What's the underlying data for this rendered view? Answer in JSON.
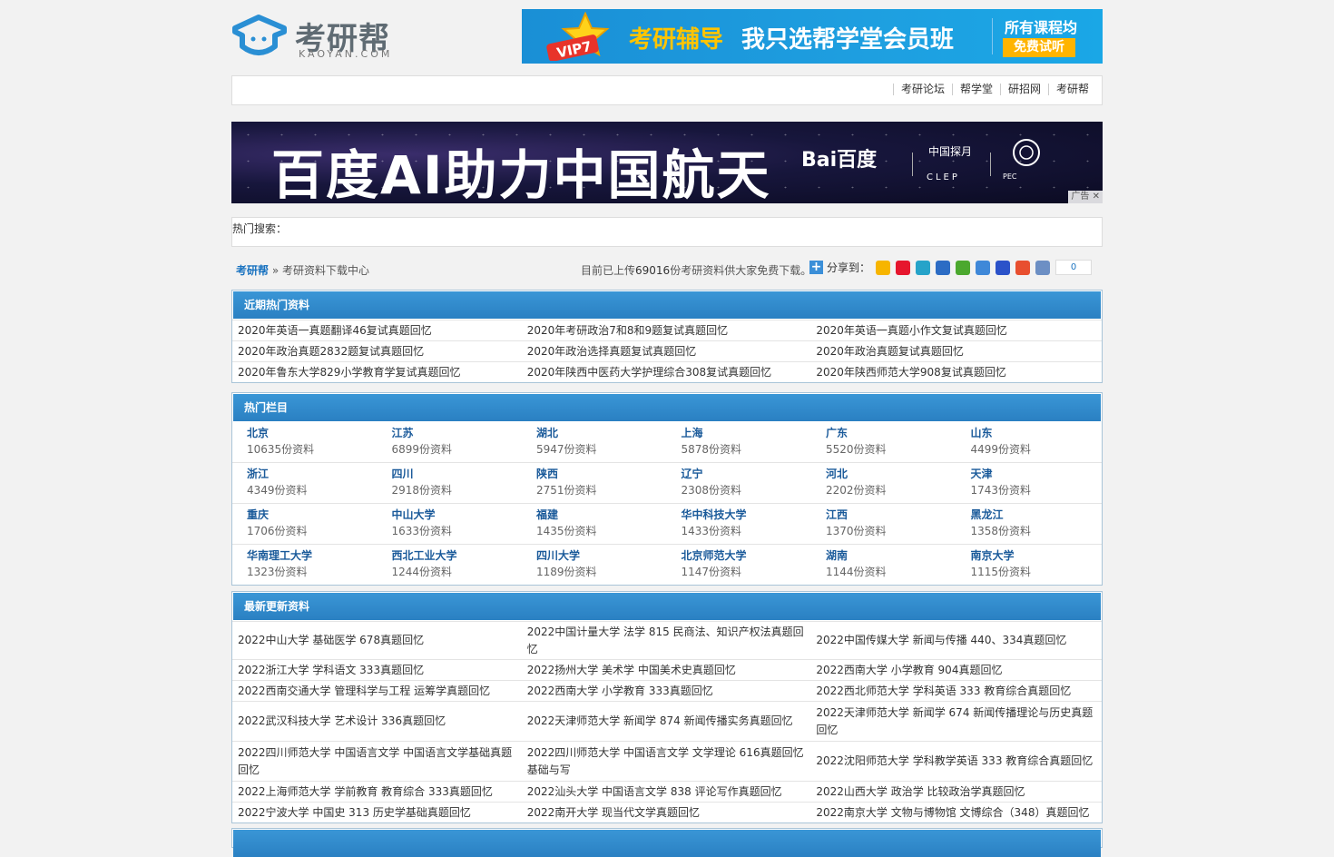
{
  "header": {
    "logo_cn": "考研帮",
    "logo_en": "KAOYAN.COM",
    "banner": {
      "vip": "VIP7",
      "text1": "考研辅导",
      "text2": "我只选帮学堂会员班",
      "text3": "所有课程均",
      "button": "免费试听"
    }
  },
  "nav": {
    "links": [
      "考研论坛",
      "帮学堂",
      "研招网",
      "考研帮"
    ]
  },
  "ad": {
    "title": "百度AI助力中国航天",
    "brand": "Bai百度",
    "cn": "中国探月",
    "clep": "CLEP",
    "pec": "PEC",
    "tag": "广告"
  },
  "hot_search": {
    "label": "热门搜索："
  },
  "breadcrumb": {
    "home": "考研帮",
    "sep": " » ",
    "current": "考研资料下载中心"
  },
  "stat": {
    "prefix": "目前已上传",
    "count": "69016",
    "suffix": "份考研资料供大家免费下载。",
    "share_label": "分享到：",
    "share_count": "0"
  },
  "colors": {
    "accent": "#2e87c8",
    "link_blue": "#1a73c0"
  },
  "hot_materials": {
    "title": "近期热门资料",
    "rows": [
      [
        "2020年英语一真题翻译46复试真题回忆",
        "2020年考研政治7和8和9题复试真题回忆",
        "2020年英语一真题小作文复试真题回忆"
      ],
      [
        "2020年政治真题2832题复试真题回忆",
        "2020年政治选择真题复试真题回忆",
        "2020年政治真题复试真题回忆"
      ],
      [
        "2020年鲁东大学829小学教育学复试真题回忆",
        "2020年陕西中医药大学护理综合308复试真题回忆",
        "2020年陕西师范大学908复试真题回忆"
      ]
    ]
  },
  "hot_columns": {
    "title": "热门栏目",
    "rows": [
      [
        {
          "name": "北京",
          "count": "10635份资料"
        },
        {
          "name": "江苏",
          "count": "6899份资料"
        },
        {
          "name": "湖北",
          "count": "5947份资料"
        },
        {
          "name": "上海",
          "count": "5878份资料"
        },
        {
          "name": "广东",
          "count": "5520份资料"
        },
        {
          "name": "山东",
          "count": "4499份资料"
        }
      ],
      [
        {
          "name": "浙江",
          "count": "4349份资料"
        },
        {
          "name": "四川",
          "count": "2918份资料"
        },
        {
          "name": "陕西",
          "count": "2751份资料"
        },
        {
          "name": "辽宁",
          "count": "2308份资料"
        },
        {
          "name": "河北",
          "count": "2202份资料"
        },
        {
          "name": "天津",
          "count": "1743份资料"
        }
      ],
      [
        {
          "name": "重庆",
          "count": "1706份资料"
        },
        {
          "name": "中山大学",
          "count": "1633份资料"
        },
        {
          "name": "福建",
          "count": "1435份资料"
        },
        {
          "name": "华中科技大学",
          "count": "1433份资料"
        },
        {
          "name": "江西",
          "count": "1370份资料"
        },
        {
          "name": "黑龙江",
          "count": "1358份资料"
        }
      ],
      [
        {
          "name": "华南理工大学",
          "count": "1323份资料"
        },
        {
          "name": "西北工业大学",
          "count": "1244份资料"
        },
        {
          "name": "四川大学",
          "count": "1189份资料"
        },
        {
          "name": "北京师范大学",
          "count": "1147份资料"
        },
        {
          "name": "湖南",
          "count": "1144份资料"
        },
        {
          "name": "南京大学",
          "count": "1115份资料"
        }
      ]
    ]
  },
  "latest": {
    "title": "最新更新资料",
    "rows": [
      [
        "2022中山大学 基础医学 678真题回忆",
        "2022中国计量大学 法学 815 民商法、知识产权法真题回忆",
        "2022中国传媒大学 新闻与传播 440、334真题回忆"
      ],
      [
        "2022浙江大学 学科语文 333真题回忆",
        "2022扬州大学 美术学 中国美术史真题回忆",
        "2022西南大学 小学教育 904真题回忆"
      ],
      [
        "2022西南交通大学 管理科学与工程 运筹学真题回忆",
        "2022西南大学 小学教育 333真题回忆",
        "2022西北师范大学 学科英语 333 教育综合真题回忆"
      ],
      [
        "2022武汉科技大学 艺术设计 336真题回忆",
        "2022天津师范大学 新闻学 874 新闻传播实务真题回忆",
        "2022天津师范大学 新闻学 674 新闻传播理论与历史真题回忆"
      ],
      [
        "2022四川师范大学 中国语言文学 中国语言文学基础真题回忆",
        "2022四川师范大学 中国语言文学 文学理论 616真题回忆基础与写",
        "2022沈阳师范大学 学科教学英语 333 教育综合真题回忆"
      ],
      [
        "2022上海师范大学 学前教育 教育综合 333真题回忆",
        "2022汕头大学 中国语言文学 838 评论写作真题回忆",
        "2022山西大学 政治学 比较政治学真题回忆"
      ],
      [
        "2022宁波大学 中国史 313 历史学基础真题回忆",
        "2022南开大学 现当代文学真题回忆",
        "2022南京大学 文物与博物馆 文博综合（348）真题回忆"
      ]
    ]
  }
}
